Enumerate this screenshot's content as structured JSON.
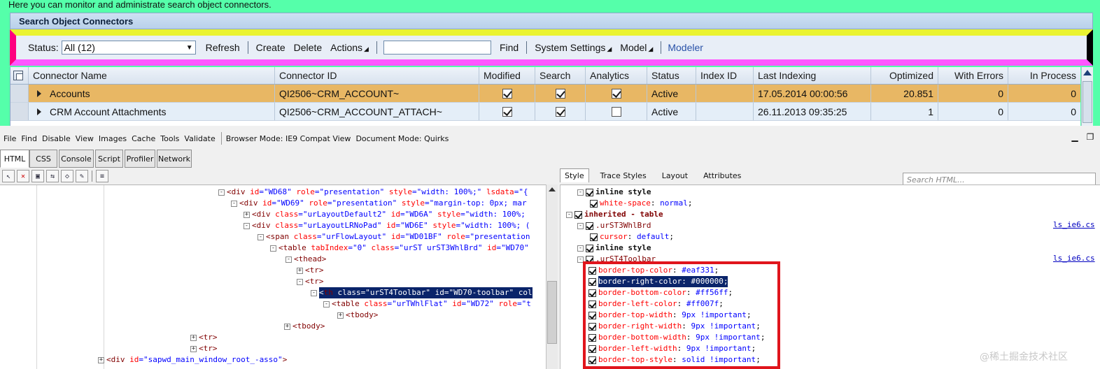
{
  "intro_text": "Here you can monitor and administrate search object connectors.",
  "panel_title": "Search Object Connectors",
  "toolbar": {
    "status_label": "Status:",
    "status_value": "All (12)",
    "refresh": "Refresh",
    "create": "Create",
    "delete": "Delete",
    "actions": "Actions",
    "find_value": "",
    "find": "Find",
    "system_settings": "System Settings",
    "model": "Model",
    "modeler": "Modeler"
  },
  "grid": {
    "columns": [
      "Connector Name",
      "Connector ID",
      "Modified",
      "Search",
      "Analytics",
      "Status",
      "Index ID",
      "Last Indexing",
      "Optimized",
      "With Errors",
      "In Process"
    ],
    "rows": [
      {
        "name": "Accounts",
        "id": "QI2506~CRM_ACCOUNT~",
        "modified": true,
        "search": true,
        "analytics": true,
        "status": "Active",
        "index_id": "",
        "last_indexing": "17.05.2014 00:00:56",
        "optimized": "20.851",
        "with_errors": "0",
        "in_process": "0"
      },
      {
        "name": "CRM Account Attachments",
        "id": "QI2506~CRM_ACCOUNT_ATTACH~",
        "modified": true,
        "search": true,
        "analytics": false,
        "status": "Active",
        "index_id": "",
        "last_indexing": "26.11.2013 09:35:25",
        "optimized": "1",
        "with_errors": "0",
        "in_process": "0"
      }
    ]
  },
  "devtools": {
    "menu": [
      "File",
      "Find",
      "Disable",
      "View",
      "Images",
      "Cache",
      "Tools",
      "Validate"
    ],
    "browser_mode": "Browser Mode: IE9 Compat View",
    "document_mode": "Document Mode: Quirks",
    "tabs": [
      "HTML",
      "CSS",
      "Console",
      "Script",
      "Profiler",
      "Network"
    ],
    "search_placeholder": "Search HTML...",
    "style_tabs": [
      "Style",
      "Trace Styles",
      "Layout",
      "Attributes"
    ],
    "html_tree": [
      {
        "pm": "-",
        "parts": [
          [
            "tg",
            "<"
          ],
          [
            "tn",
            "div"
          ],
          [
            "s",
            " "
          ],
          [
            "an",
            "id"
          ],
          [
            "eq",
            "="
          ],
          [
            "av",
            "\"WD68\""
          ],
          [
            "s",
            " "
          ],
          [
            "an",
            "role"
          ],
          [
            "eq",
            "="
          ],
          [
            "av",
            "\"presentation\""
          ],
          [
            "s",
            " "
          ],
          [
            "an",
            "style"
          ],
          [
            "eq",
            "="
          ],
          [
            "av",
            "\"width: 100%;\""
          ],
          [
            "s",
            " "
          ],
          [
            "an",
            "lsdata"
          ],
          [
            "eq",
            "="
          ],
          [
            "av",
            "\"{"
          ]
        ]
      },
      {
        "pm": "-",
        "parts": [
          [
            "tg",
            "<"
          ],
          [
            "tn",
            "div"
          ],
          [
            "s",
            " "
          ],
          [
            "an",
            "id"
          ],
          [
            "eq",
            "="
          ],
          [
            "av",
            "\"WD69\""
          ],
          [
            "s",
            " "
          ],
          [
            "an",
            "role"
          ],
          [
            "eq",
            "="
          ],
          [
            "av",
            "\"presentation\""
          ],
          [
            "s",
            " "
          ],
          [
            "an",
            "style"
          ],
          [
            "eq",
            "="
          ],
          [
            "av",
            "\"margin-top: 0px; mar"
          ]
        ]
      },
      {
        "pm": "+",
        "parts": [
          [
            "tg",
            "<"
          ],
          [
            "tn",
            "div"
          ],
          [
            "s",
            " "
          ],
          [
            "an",
            "class"
          ],
          [
            "eq",
            "="
          ],
          [
            "av",
            "\"urLayoutDefault2\""
          ],
          [
            "s",
            " "
          ],
          [
            "an",
            "id"
          ],
          [
            "eq",
            "="
          ],
          [
            "av",
            "\"WD6A\""
          ],
          [
            "s",
            " "
          ],
          [
            "an",
            "style"
          ],
          [
            "eq",
            "="
          ],
          [
            "av",
            "\"width: 100%;"
          ]
        ]
      },
      {
        "pm": "-",
        "parts": [
          [
            "tg",
            "<"
          ],
          [
            "tn",
            "div"
          ],
          [
            "s",
            " "
          ],
          [
            "an",
            "class"
          ],
          [
            "eq",
            "="
          ],
          [
            "av",
            "\"urLayoutLRNoPad\""
          ],
          [
            "s",
            " "
          ],
          [
            "an",
            "id"
          ],
          [
            "eq",
            "="
          ],
          [
            "av",
            "\"WD6E\""
          ],
          [
            "s",
            " "
          ],
          [
            "an",
            "style"
          ],
          [
            "eq",
            "="
          ],
          [
            "av",
            "\"width: 100%; ("
          ]
        ]
      },
      {
        "pm": "-",
        "parts": [
          [
            "tg",
            "<"
          ],
          [
            "tn",
            "span"
          ],
          [
            "s",
            " "
          ],
          [
            "an",
            "class"
          ],
          [
            "eq",
            "="
          ],
          [
            "av",
            "\"urFlowLayout\""
          ],
          [
            "s",
            " "
          ],
          [
            "an",
            "id"
          ],
          [
            "eq",
            "="
          ],
          [
            "av",
            "\"WD01BF\""
          ],
          [
            "s",
            " "
          ],
          [
            "an",
            "role"
          ],
          [
            "eq",
            "="
          ],
          [
            "av",
            "\"presentation"
          ]
        ]
      },
      {
        "pm": "-",
        "parts": [
          [
            "tg",
            "<"
          ],
          [
            "tn",
            "table"
          ],
          [
            "s",
            " "
          ],
          [
            "an",
            "tabIndex"
          ],
          [
            "eq",
            "="
          ],
          [
            "av",
            "\"0\""
          ],
          [
            "s",
            " "
          ],
          [
            "an",
            "class"
          ],
          [
            "eq",
            "="
          ],
          [
            "av",
            "\"urST urST3WhlBrd\""
          ],
          [
            "s",
            " "
          ],
          [
            "an",
            "id"
          ],
          [
            "eq",
            "="
          ],
          [
            "av",
            "\"WD70\""
          ]
        ]
      },
      {
        "pm": "-",
        "parts": [
          [
            "tg",
            "<"
          ],
          [
            "tn",
            "thead"
          ],
          [
            "tg",
            ">"
          ]
        ]
      },
      {
        "pm": "+",
        "parts": [
          [
            "tg",
            "<"
          ],
          [
            "tn",
            "tr"
          ],
          [
            "tg",
            ">"
          ]
        ]
      },
      {
        "pm": "-",
        "parts": [
          [
            "tg",
            "<"
          ],
          [
            "tn",
            "tr"
          ],
          [
            "tg",
            ">"
          ]
        ]
      },
      {
        "pm": "-",
        "parts": [
          [
            "tg",
            "<"
          ],
          [
            "tn",
            "th"
          ],
          [
            "s",
            " "
          ],
          [
            "an",
            "class"
          ],
          [
            "eq",
            "="
          ],
          [
            "av",
            "\"urST4Toolbar\""
          ],
          [
            "s",
            " "
          ],
          [
            "an",
            "id"
          ],
          [
            "eq",
            "="
          ],
          [
            "av",
            "\"WD70-toolbar\""
          ],
          [
            "s",
            " "
          ],
          [
            "an",
            "col"
          ]
        ]
      },
      {
        "pm": "-",
        "parts": [
          [
            "tg",
            "<"
          ],
          [
            "tn",
            "table"
          ],
          [
            "s",
            " "
          ],
          [
            "an",
            "class"
          ],
          [
            "eq",
            "="
          ],
          [
            "av",
            "\"urTWhlFlat\""
          ],
          [
            "s",
            " "
          ],
          [
            "an",
            "id"
          ],
          [
            "eq",
            "="
          ],
          [
            "av",
            "\"WD72\""
          ],
          [
            "s",
            " "
          ],
          [
            "an",
            "role"
          ],
          [
            "eq",
            "="
          ],
          [
            "av",
            "\"t"
          ]
        ]
      },
      {
        "pm": "+",
        "parts": [
          [
            "tg",
            "<"
          ],
          [
            "tn",
            "tbody"
          ],
          [
            "tg",
            ">"
          ]
        ]
      },
      {
        "pm": "+",
        "parts": [
          [
            "tg",
            "<"
          ],
          [
            "tn",
            "tbody"
          ],
          [
            "tg",
            ">"
          ]
        ]
      },
      {
        "pm": "+",
        "parts": [
          [
            "tg",
            "<"
          ],
          [
            "tn",
            "tr"
          ],
          [
            "tg",
            ">"
          ]
        ]
      },
      {
        "pm": "+",
        "parts": [
          [
            "tg",
            "<"
          ],
          [
            "tn",
            "tr"
          ],
          [
            "tg",
            ">"
          ]
        ]
      },
      {
        "pm": "+",
        "parts": [
          [
            "tg",
            "<"
          ],
          [
            "tn",
            "div"
          ],
          [
            "s",
            " "
          ],
          [
            "an",
            "id"
          ],
          [
            "eq",
            "="
          ],
          [
            "av",
            "\"sapwd_main_window_root_-asso\""
          ],
          [
            "tg",
            ">"
          ]
        ]
      }
    ],
    "style_rules": [
      {
        "kind": "header",
        "check": true,
        "pm": "-",
        "text": "inline style"
      },
      {
        "kind": "prop",
        "check": true,
        "prop": "white-space",
        "val": "normal"
      },
      {
        "kind": "inherited",
        "check": true,
        "pm": "-",
        "text": "inherited - table"
      },
      {
        "kind": "selector",
        "check": true,
        "pm": "-",
        "text": ".urST3WhlBrd",
        "src": "ls_ie6.cs"
      },
      {
        "kind": "prop",
        "check": true,
        "prop": "cursor",
        "val": "default"
      },
      {
        "kind": "header",
        "check": true,
        "pm": "-",
        "text": "inline style"
      },
      {
        "kind": "selector",
        "check": true,
        "pm": "-",
        "text": ".urST4Toolbar",
        "src": "ls_ie6.cs"
      },
      {
        "kind": "prop",
        "check": true,
        "prop": "border-top-color",
        "val": "#eaf331"
      },
      {
        "kind": "prop",
        "check": true,
        "prop": "border-right-color",
        "val": "#000000",
        "selected": true
      },
      {
        "kind": "prop",
        "check": true,
        "prop": "border-bottom-color",
        "val": "#ff56ff"
      },
      {
        "kind": "prop",
        "check": true,
        "prop": "border-left-color",
        "val": "#ff007f"
      },
      {
        "kind": "prop",
        "check": true,
        "prop": "border-top-width",
        "val": "9px !important"
      },
      {
        "kind": "prop",
        "check": true,
        "prop": "border-right-width",
        "val": "9px !important"
      },
      {
        "kind": "prop",
        "check": true,
        "prop": "border-bottom-width",
        "val": "9px !important"
      },
      {
        "kind": "prop",
        "check": true,
        "prop": "border-left-width",
        "val": "9px !important"
      },
      {
        "kind": "prop",
        "check": true,
        "prop": "border-top-style",
        "val": "solid !important"
      }
    ]
  },
  "watermark": "@稀土掘金技术社区",
  "colors": {
    "page_bg": "#55ffaa",
    "toolbar_border_top": "#eaf331",
    "toolbar_border_right": "#000000",
    "toolbar_border_bottom": "#ff56ff",
    "toolbar_border_left": "#ff007f",
    "selected_row": "#e8b764",
    "highlight_box": "#e0151c"
  }
}
